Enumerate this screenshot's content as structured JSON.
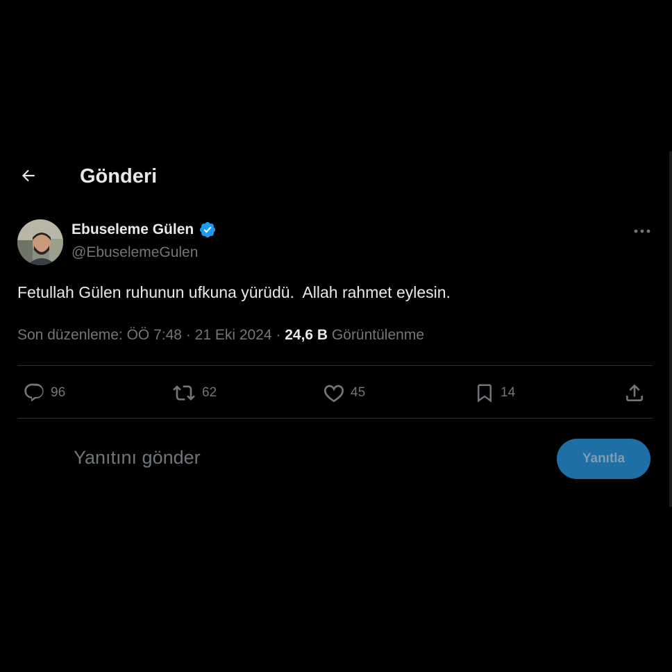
{
  "header": {
    "title": "Gönderi",
    "back_icon": "arrow-left-icon"
  },
  "author": {
    "name": "Ebuseleme Gülen",
    "handle": "@EbuselemeGulen",
    "verified": true,
    "verified_color": "#1d9bf0"
  },
  "tweet": {
    "text": "Fetullah Gülen ruhunun ufkuna yürüdü.  Allah rahmet eylesin.",
    "edited_label": "Son düzenleme: ÖÖ 7:48 · 21 Eki 2024 · ",
    "views_count": "24,6 B",
    "views_label": " Görüntülenme"
  },
  "actions": {
    "replies": "96",
    "retweets": "62",
    "likes": "45",
    "bookmarks": "14"
  },
  "composer": {
    "placeholder": "Yanıtını gönder",
    "button_label": "Yanıtla"
  },
  "colors": {
    "background": "#000000",
    "text_primary": "#e7e9ea",
    "text_secondary": "#71767b",
    "accent": "#1d9bf0"
  }
}
